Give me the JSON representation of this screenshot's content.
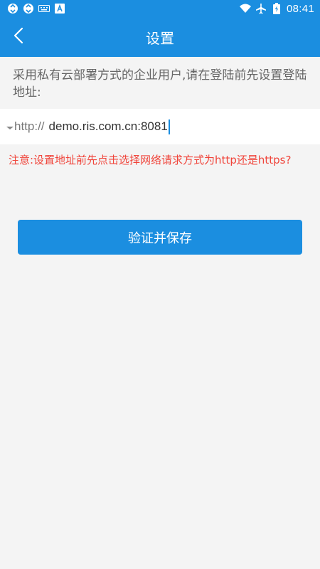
{
  "status_bar": {
    "time": "08:41",
    "left_icons": [
      "sync-icon",
      "sync-icon",
      "keyboard-icon",
      "a-icon"
    ],
    "right_icons": [
      "wifi-icon",
      "airplane-icon",
      "battery-icon"
    ]
  },
  "app_bar": {
    "title": "设置",
    "back_icon": "chevron-left-icon"
  },
  "intro": {
    "text": "采用私有云部署方式的企业用户,请在登陆前先设置登陆地址:"
  },
  "url_field": {
    "protocol": "http://",
    "value": "demo.ris.com.cn:8081"
  },
  "notice": {
    "text": "注意:设置地址前先点击选择网络请求方式为http还是https?"
  },
  "actions": {
    "save_label": "验证并保存"
  },
  "colors": {
    "primary": "#1b8ee0",
    "notice": "#f0443a",
    "background": "#f4f4f4"
  }
}
